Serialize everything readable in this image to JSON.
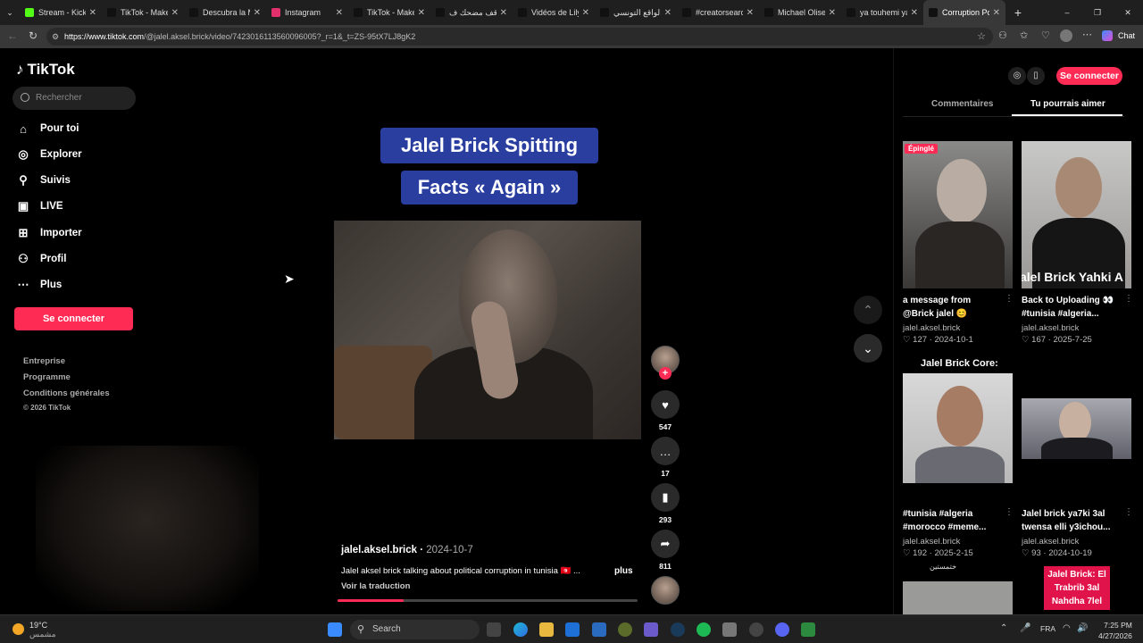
{
  "browser": {
    "tabs": [
      {
        "title": "Stream - Kick D",
        "color": "#53fc18"
      },
      {
        "title": "TikTok - Make Y",
        "color": "#111111"
      },
      {
        "title": "Descubra la Ma",
        "color": "#111111"
      },
      {
        "title": "Instagram",
        "color": "#e1306c"
      },
      {
        "title": "TikTok - Make Y",
        "color": "#111111"
      },
      {
        "title": "موقف مضحك ف",
        "color": "#111111"
      },
      {
        "title": "Vidéos de Lily E",
        "color": "#111111"
      },
      {
        "title": "الواقع التونسي",
        "color": "#111111"
      },
      {
        "title": "#creatorsearch",
        "color": "#111111"
      },
      {
        "title": "Michael Olise L",
        "color": "#111111"
      },
      {
        "title": "ya touhemi ya",
        "color": "#111111"
      },
      {
        "title": "Corruption Pol",
        "color": "#111111",
        "active": true
      }
    ],
    "url_host": "https://www.tiktok.com",
    "url_path": "/@jalel.aksel.brick/video/7423016113560096005?_r=1&_t=ZS-95tX7LJ8gK2",
    "chat_label": "Chat"
  },
  "sidebar": {
    "logo": "TikTok",
    "search_placeholder": "Rechercher",
    "nav": [
      {
        "label": "Pour toi",
        "icon": "home-icon"
      },
      {
        "label": "Explorer",
        "icon": "compass-icon"
      },
      {
        "label": "Suivis",
        "icon": "following-icon"
      },
      {
        "label": "LIVE",
        "icon": "live-icon"
      },
      {
        "label": "Importer",
        "icon": "upload-icon"
      },
      {
        "label": "Profil",
        "icon": "profile-icon"
      },
      {
        "label": "Plus",
        "icon": "more-icon"
      }
    ],
    "login": "Se connecter",
    "footer": [
      "Entreprise",
      "Programme",
      "Conditions générales"
    ],
    "copyright": "© 2026 TikTok"
  },
  "video": {
    "caption_line1": "Jalel Brick Spitting",
    "caption_line2": "Facts « Again »",
    "author": "jalel.aksel.brick",
    "date": "2024-10-7",
    "description": "Jalel aksel brick talking about political corruption in tunisia 🇹🇳 ...",
    "more": "plus",
    "translate": "Voir la traduction",
    "progress": 0.22,
    "likes": "547",
    "comments": "17",
    "saves": "293",
    "shares": "811"
  },
  "right_panel": {
    "login": "Se connecter",
    "tabs": [
      "Commentaires",
      "Tu pourrais aimer"
    ],
    "active_tab": "Tu pourrais aimer",
    "cards": [
      {
        "badge": "Épinglé",
        "title": "a message from @Brick jalel 😊 #tunisia...",
        "author": "jalel.aksel.brick",
        "likes": "127",
        "date": "2024-10-1"
      },
      {
        "overlay": "alel Brick Yahki A",
        "title": "Back to Uploading 👀 #tunisia #algeria...",
        "author": "jalel.aksel.brick",
        "likes": "167",
        "date": "2025-7-25"
      },
      {
        "overlay": "Jalel Brick Core:",
        "title": "#tunisia #algeria #morocco #meme...",
        "author": "jalel.aksel.brick",
        "likes": "192",
        "date": "2025-2-15"
      },
      {
        "title": "Jalel brick ya7ki 3al twensa elli y3ichou...",
        "author": "jalel.aksel.brick",
        "likes": "93",
        "date": "2024-10-19"
      }
    ],
    "bottom_overlay": "Jalel Brick: El Trabrib 3al Nahdha 7lel",
    "bottom_left_text": "ختمستين"
  },
  "taskbar": {
    "temp": "19°C",
    "weather_text": "مشمس",
    "search": "Search",
    "lang": "FRA",
    "time": "7:25 PM",
    "date": "4/27/2026"
  }
}
